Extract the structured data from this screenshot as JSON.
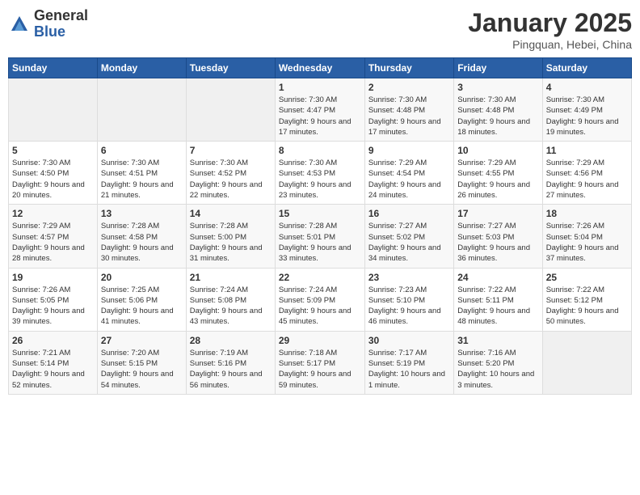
{
  "logo": {
    "general": "General",
    "blue": "Blue"
  },
  "title": "January 2025",
  "location": "Pingquan, Hebei, China",
  "days_of_week": [
    "Sunday",
    "Monday",
    "Tuesday",
    "Wednesday",
    "Thursday",
    "Friday",
    "Saturday"
  ],
  "weeks": [
    [
      {
        "day": "",
        "sunrise": "",
        "sunset": "",
        "daylight": ""
      },
      {
        "day": "",
        "sunrise": "",
        "sunset": "",
        "daylight": ""
      },
      {
        "day": "",
        "sunrise": "",
        "sunset": "",
        "daylight": ""
      },
      {
        "day": "1",
        "sunrise": "Sunrise: 7:30 AM",
        "sunset": "Sunset: 4:47 PM",
        "daylight": "Daylight: 9 hours and 17 minutes."
      },
      {
        "day": "2",
        "sunrise": "Sunrise: 7:30 AM",
        "sunset": "Sunset: 4:48 PM",
        "daylight": "Daylight: 9 hours and 17 minutes."
      },
      {
        "day": "3",
        "sunrise": "Sunrise: 7:30 AM",
        "sunset": "Sunset: 4:48 PM",
        "daylight": "Daylight: 9 hours and 18 minutes."
      },
      {
        "day": "4",
        "sunrise": "Sunrise: 7:30 AM",
        "sunset": "Sunset: 4:49 PM",
        "daylight": "Daylight: 9 hours and 19 minutes."
      }
    ],
    [
      {
        "day": "5",
        "sunrise": "Sunrise: 7:30 AM",
        "sunset": "Sunset: 4:50 PM",
        "daylight": "Daylight: 9 hours and 20 minutes."
      },
      {
        "day": "6",
        "sunrise": "Sunrise: 7:30 AM",
        "sunset": "Sunset: 4:51 PM",
        "daylight": "Daylight: 9 hours and 21 minutes."
      },
      {
        "day": "7",
        "sunrise": "Sunrise: 7:30 AM",
        "sunset": "Sunset: 4:52 PM",
        "daylight": "Daylight: 9 hours and 22 minutes."
      },
      {
        "day": "8",
        "sunrise": "Sunrise: 7:30 AM",
        "sunset": "Sunset: 4:53 PM",
        "daylight": "Daylight: 9 hours and 23 minutes."
      },
      {
        "day": "9",
        "sunrise": "Sunrise: 7:29 AM",
        "sunset": "Sunset: 4:54 PM",
        "daylight": "Daylight: 9 hours and 24 minutes."
      },
      {
        "day": "10",
        "sunrise": "Sunrise: 7:29 AM",
        "sunset": "Sunset: 4:55 PM",
        "daylight": "Daylight: 9 hours and 26 minutes."
      },
      {
        "day": "11",
        "sunrise": "Sunrise: 7:29 AM",
        "sunset": "Sunset: 4:56 PM",
        "daylight": "Daylight: 9 hours and 27 minutes."
      }
    ],
    [
      {
        "day": "12",
        "sunrise": "Sunrise: 7:29 AM",
        "sunset": "Sunset: 4:57 PM",
        "daylight": "Daylight: 9 hours and 28 minutes."
      },
      {
        "day": "13",
        "sunrise": "Sunrise: 7:28 AM",
        "sunset": "Sunset: 4:58 PM",
        "daylight": "Daylight: 9 hours and 30 minutes."
      },
      {
        "day": "14",
        "sunrise": "Sunrise: 7:28 AM",
        "sunset": "Sunset: 5:00 PM",
        "daylight": "Daylight: 9 hours and 31 minutes."
      },
      {
        "day": "15",
        "sunrise": "Sunrise: 7:28 AM",
        "sunset": "Sunset: 5:01 PM",
        "daylight": "Daylight: 9 hours and 33 minutes."
      },
      {
        "day": "16",
        "sunrise": "Sunrise: 7:27 AM",
        "sunset": "Sunset: 5:02 PM",
        "daylight": "Daylight: 9 hours and 34 minutes."
      },
      {
        "day": "17",
        "sunrise": "Sunrise: 7:27 AM",
        "sunset": "Sunset: 5:03 PM",
        "daylight": "Daylight: 9 hours and 36 minutes."
      },
      {
        "day": "18",
        "sunrise": "Sunrise: 7:26 AM",
        "sunset": "Sunset: 5:04 PM",
        "daylight": "Daylight: 9 hours and 37 minutes."
      }
    ],
    [
      {
        "day": "19",
        "sunrise": "Sunrise: 7:26 AM",
        "sunset": "Sunset: 5:05 PM",
        "daylight": "Daylight: 9 hours and 39 minutes."
      },
      {
        "day": "20",
        "sunrise": "Sunrise: 7:25 AM",
        "sunset": "Sunset: 5:06 PM",
        "daylight": "Daylight: 9 hours and 41 minutes."
      },
      {
        "day": "21",
        "sunrise": "Sunrise: 7:24 AM",
        "sunset": "Sunset: 5:08 PM",
        "daylight": "Daylight: 9 hours and 43 minutes."
      },
      {
        "day": "22",
        "sunrise": "Sunrise: 7:24 AM",
        "sunset": "Sunset: 5:09 PM",
        "daylight": "Daylight: 9 hours and 45 minutes."
      },
      {
        "day": "23",
        "sunrise": "Sunrise: 7:23 AM",
        "sunset": "Sunset: 5:10 PM",
        "daylight": "Daylight: 9 hours and 46 minutes."
      },
      {
        "day": "24",
        "sunrise": "Sunrise: 7:22 AM",
        "sunset": "Sunset: 5:11 PM",
        "daylight": "Daylight: 9 hours and 48 minutes."
      },
      {
        "day": "25",
        "sunrise": "Sunrise: 7:22 AM",
        "sunset": "Sunset: 5:12 PM",
        "daylight": "Daylight: 9 hours and 50 minutes."
      }
    ],
    [
      {
        "day": "26",
        "sunrise": "Sunrise: 7:21 AM",
        "sunset": "Sunset: 5:14 PM",
        "daylight": "Daylight: 9 hours and 52 minutes."
      },
      {
        "day": "27",
        "sunrise": "Sunrise: 7:20 AM",
        "sunset": "Sunset: 5:15 PM",
        "daylight": "Daylight: 9 hours and 54 minutes."
      },
      {
        "day": "28",
        "sunrise": "Sunrise: 7:19 AM",
        "sunset": "Sunset: 5:16 PM",
        "daylight": "Daylight: 9 hours and 56 minutes."
      },
      {
        "day": "29",
        "sunrise": "Sunrise: 7:18 AM",
        "sunset": "Sunset: 5:17 PM",
        "daylight": "Daylight: 9 hours and 59 minutes."
      },
      {
        "day": "30",
        "sunrise": "Sunrise: 7:17 AM",
        "sunset": "Sunset: 5:19 PM",
        "daylight": "Daylight: 10 hours and 1 minute."
      },
      {
        "day": "31",
        "sunrise": "Sunrise: 7:16 AM",
        "sunset": "Sunset: 5:20 PM",
        "daylight": "Daylight: 10 hours and 3 minutes."
      },
      {
        "day": "",
        "sunrise": "",
        "sunset": "",
        "daylight": ""
      }
    ]
  ]
}
